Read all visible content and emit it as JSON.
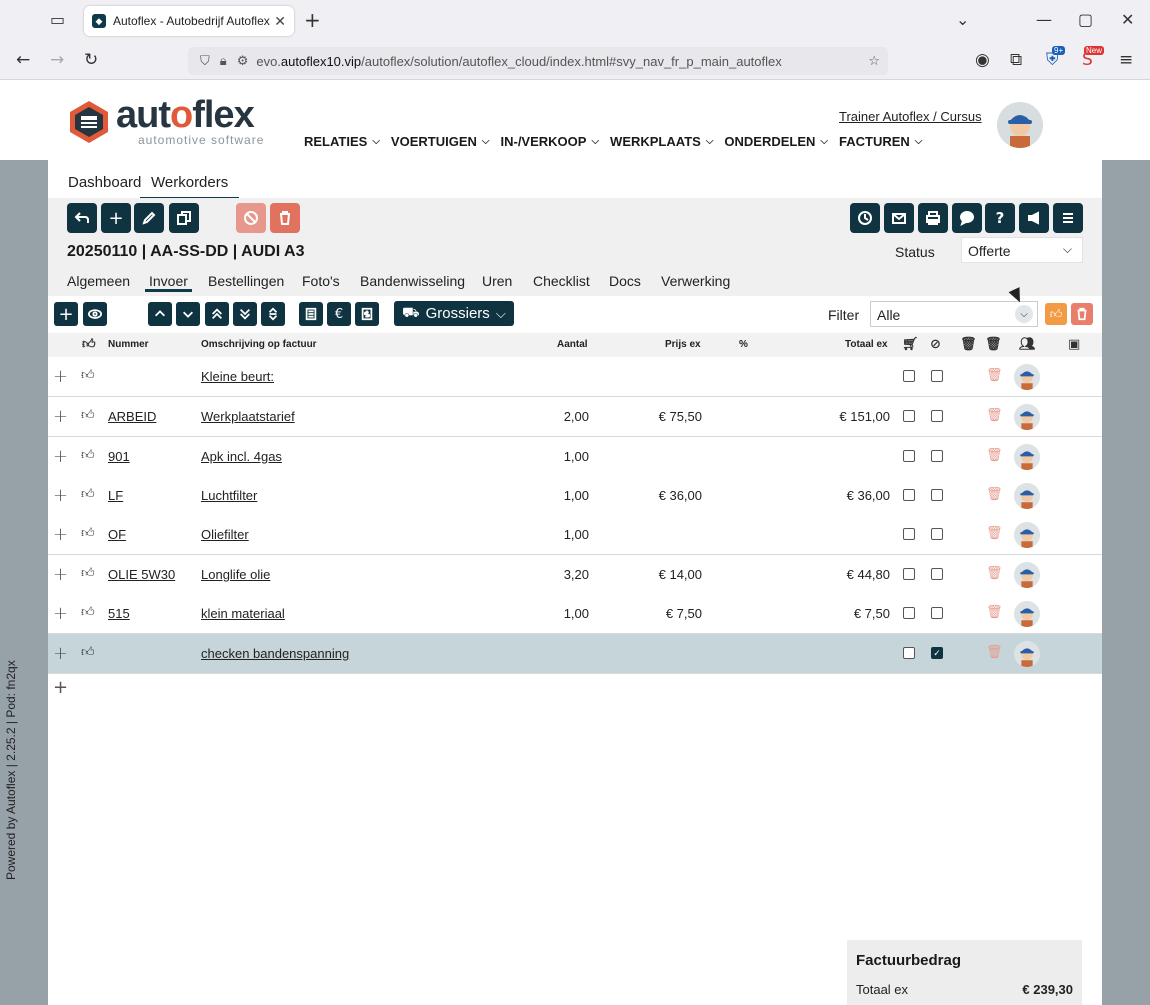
{
  "browser": {
    "tab_title": "Autoflex - Autobedrijf Autoflex",
    "url_prefix": "evo.",
    "url_domain": "autoflex10.vip",
    "url_path": "/autoflex/solution/autoflex_cloud/index.html#svy_nav_fr_p_main_autoflex",
    "ext_badge_1": "9+",
    "ext_badge_2": "New"
  },
  "header": {
    "logo_main_1": "aut",
    "logo_main_2": "flex",
    "logo_o": "o",
    "logo_sub": "automotive software",
    "nav": [
      "RELATIES",
      "VOERTUIGEN",
      "IN-/VERKOOP",
      "WERKPLAATS",
      "ONDERDELEN",
      "FACTUREN"
    ],
    "user": "Trainer Autoflex / Cursus"
  },
  "sidebar_text": "Powered by Autoflex | 2.25.2 | Pod: fn2qx",
  "top_tabs": [
    "Dashboard",
    "Werkorders"
  ],
  "workorder": {
    "title": "20250110 | AA-SS-DD | AUDI A3",
    "status_label": "Status",
    "status_value": "Offerte"
  },
  "sub_tabs": [
    "Algemeen",
    "Invoer",
    "Bestellingen",
    "Foto's",
    "Bandenwisseling",
    "Uren",
    "Checklist",
    "Docs",
    "Verwerking"
  ],
  "toolbar": {
    "grossiers": "Grossiers",
    "filter_label": "Filter",
    "filter_value": "Alle"
  },
  "table": {
    "headers": {
      "nummer": "Nummer",
      "omschrijving": "Omschrijving op factuur",
      "aantal": "Aantal",
      "prijs": "Prijs ex",
      "korting": "%",
      "totaal": "Totaal ex"
    },
    "rows": [
      {
        "nummer": "",
        "omschrijving": "Kleine beurt:",
        "aantal": "",
        "prijs": "",
        "totaal": "",
        "cb2": false
      },
      {
        "nummer": "ARBEID",
        "omschrijving": "Werkplaatstarief",
        "aantal": "2,00",
        "prijs": "€ 75,50",
        "totaal": "€ 151,00",
        "cb2": false
      },
      {
        "nummer": "901",
        "omschrijving": "Apk incl. 4gas",
        "aantal": "1,00",
        "prijs": "",
        "totaal": "",
        "cb2": false
      },
      {
        "nummer": "LF",
        "omschrijving": "Luchtfilter",
        "aantal": "1,00",
        "prijs": "€ 36,00",
        "totaal": "€ 36,00",
        "cb2": false
      },
      {
        "nummer": "OF",
        "omschrijving": "Oliefilter",
        "aantal": "1,00",
        "prijs": "",
        "totaal": "",
        "cb2": false
      },
      {
        "nummer": "OLIE 5W30",
        "omschrijving": "Longlife olie",
        "aantal": "3,20",
        "prijs": "€ 14,00",
        "totaal": "€ 44,80",
        "cb2": false
      },
      {
        "nummer": "515",
        "omschrijving": "klein materiaal",
        "aantal": "1,00",
        "prijs": "€ 7,50",
        "totaal": "€ 7,50",
        "cb2": false
      },
      {
        "nummer": "",
        "omschrijving": "checken bandenspanning",
        "aantal": "",
        "prijs": "",
        "totaal": "",
        "cb2": true
      }
    ]
  },
  "factuur": {
    "title": "Factuurbedrag",
    "label": "Totaal ex",
    "value": "€ 239,30"
  },
  "colors": {
    "dark_button": "#0f3340",
    "accent_orange": "#e05a3a",
    "selected_row": "#c6d5d9",
    "side_gray": "#97a1a8"
  }
}
